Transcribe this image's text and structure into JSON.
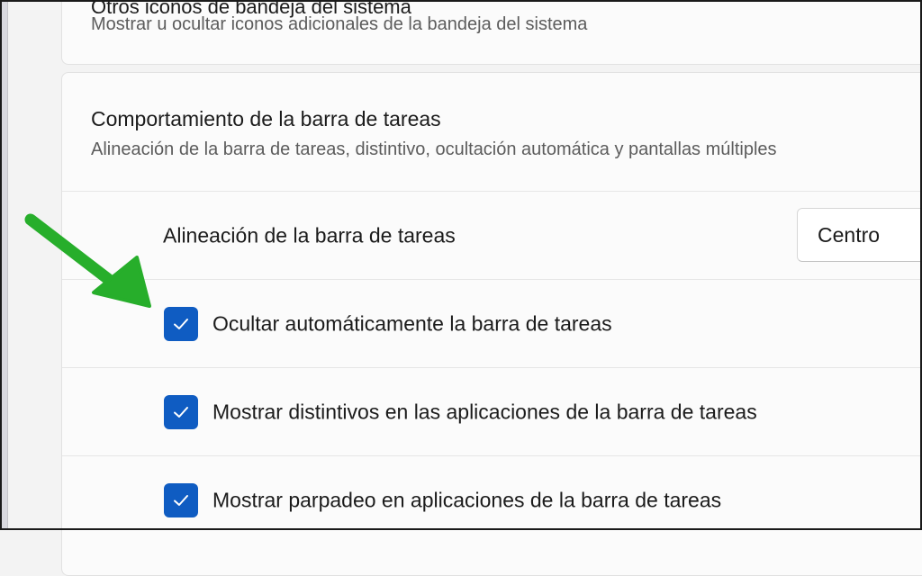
{
  "top_card": {
    "title": "Otros iconos de bandeja del sistema",
    "subtitle": "Mostrar u ocultar iconos adicionales de la bandeja del sistema"
  },
  "taskbar_behaviors": {
    "title": "Comportamiento de la barra de tareas",
    "subtitle": "Alineación de la barra de tareas, distintivo, ocultación automática y pantallas múltiples",
    "alignment": {
      "label": "Alineación de la barra de tareas",
      "value": "Centro"
    },
    "options": [
      {
        "label": "Ocultar automáticamente la barra de tareas",
        "checked": true
      },
      {
        "label": "Mostrar distintivos en las aplicaciones de la barra de tareas",
        "checked": true
      },
      {
        "label": "Mostrar parpadeo en aplicaciones de la barra de tareas",
        "checked": true
      }
    ]
  },
  "annotation": {
    "arrow_color": "#27ae2b",
    "accent_color": "#0f5cc2"
  }
}
